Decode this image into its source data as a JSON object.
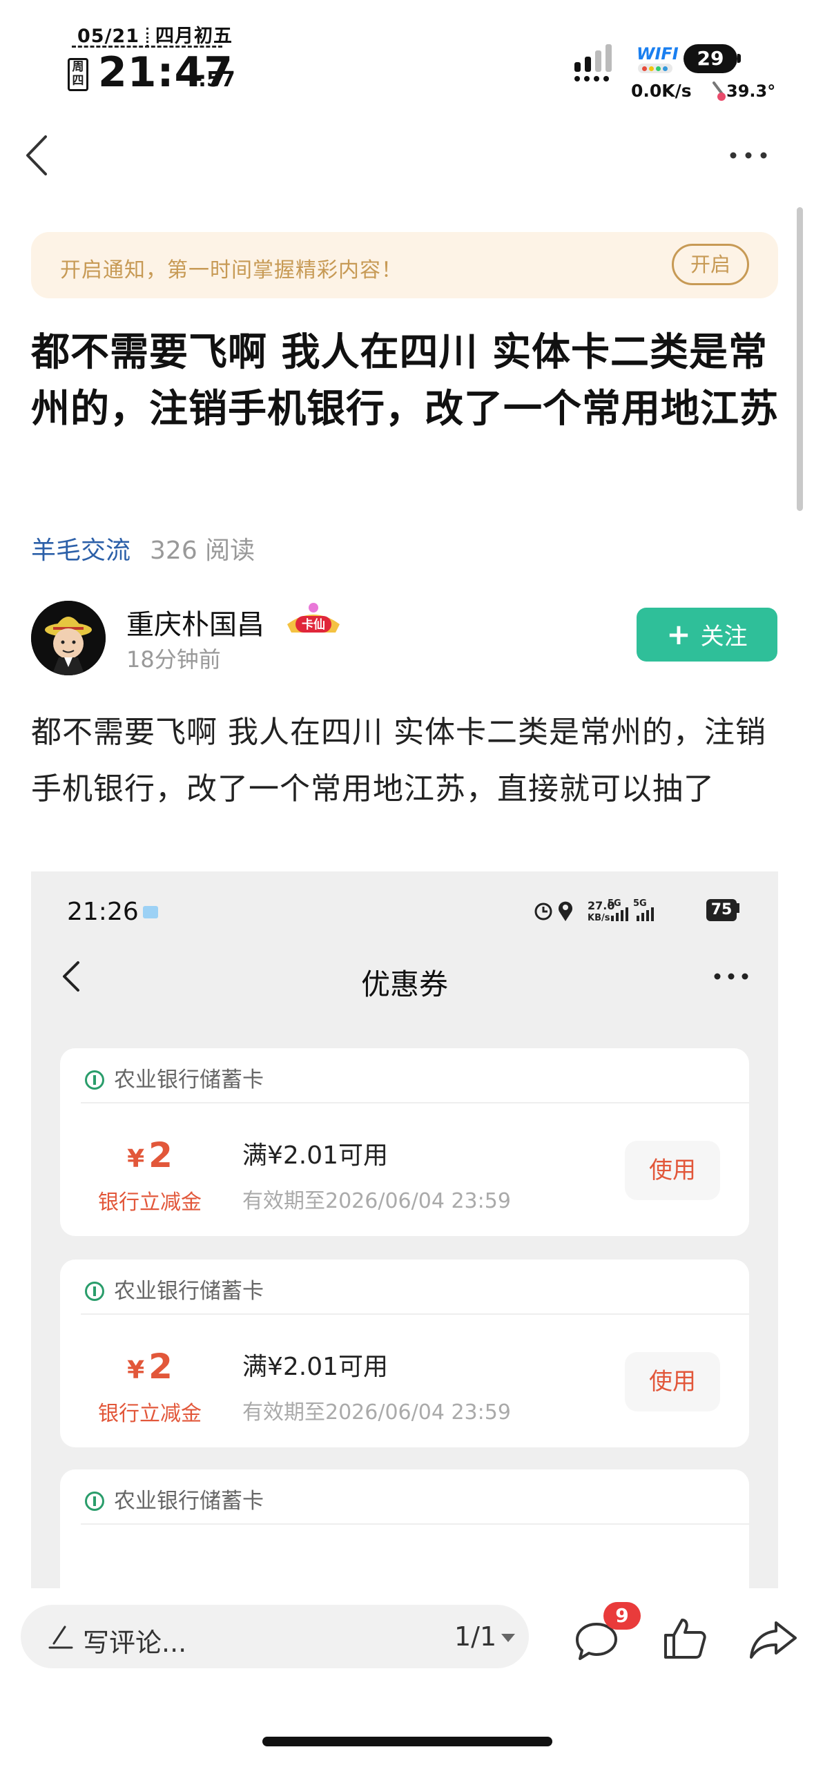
{
  "status_bar": {
    "date": "05/21",
    "lunar": "四月初五",
    "weekday": "周四",
    "time": "21:47",
    "seconds": ":57",
    "wifi_label": "WIFI",
    "battery": "29",
    "net_speed": "0.0K/s",
    "temperature": "39.3°"
  },
  "nav": {
    "back_icon": "chevron-left-icon",
    "more_icon": "more-dots-icon"
  },
  "notify": {
    "text": "开启通知，第一时间掌握精彩内容！",
    "button": "开启"
  },
  "post": {
    "title": "都不需要飞啊 我人在四川 实体卡二类是常州的，注销手机银行，改了一个常用地江苏",
    "category": "羊毛交流",
    "reads": "326 阅读",
    "body": "都不需要飞啊   我人在四川  实体卡二类是常州的，注销手机银行，改了一个常用地江苏，直接就可以抽了"
  },
  "author": {
    "name": "重庆朴国昌",
    "badge": "卡仙",
    "time": "18分钟前",
    "follow_plus": "+",
    "follow_label": "关注"
  },
  "screenshot": {
    "time": "21:26",
    "net_speed_top": "27.0",
    "net_speed_bottom": "KB/s",
    "battery": "75",
    "page_title": "优惠券",
    "coupons": [
      {
        "bank": "农业银行储蓄卡",
        "currency": "¥",
        "amount": "2",
        "type": "银行立减金",
        "condition": "满¥2.01可用",
        "validity": "有效期至2026/06/04 23:59",
        "action": "使用"
      },
      {
        "bank": "农业银行储蓄卡",
        "currency": "¥",
        "amount": "2",
        "type": "银行立减金",
        "condition": "满¥2.01可用",
        "validity": "有效期至2026/06/04 23:59",
        "action": "使用"
      },
      {
        "bank": "农业银行储蓄卡"
      }
    ]
  },
  "bottom_bar": {
    "comment_placeholder": "写评论...",
    "page_indicator": "1/1",
    "comment_count": "9"
  },
  "colors": {
    "accent_green": "#2fbf99",
    "link_blue": "#2b5fa8",
    "notify_gold": "#c79a55",
    "coupon_red": "#e2573a",
    "badge_red": "#e93b3b"
  }
}
